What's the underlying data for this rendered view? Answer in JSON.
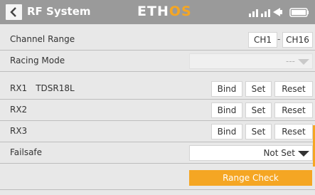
{
  "header": {
    "title": "RF System",
    "logo_prefix": "ETH",
    "logo_suffix": "OS"
  },
  "rows": {
    "channel_range": {
      "label": "Channel Range",
      "from": "CH1",
      "separator": "-",
      "to": "CH16"
    },
    "racing_mode": {
      "label": "Racing Mode",
      "value": "---"
    },
    "rx1": {
      "label": "RX1",
      "model": "TDSR18L",
      "bind": "Bind",
      "set": "Set",
      "reset": "Reset"
    },
    "rx2": {
      "label": "RX2",
      "bind": "Bind",
      "set": "Set",
      "reset": "Reset"
    },
    "rx3": {
      "label": "RX3",
      "bind": "Bind",
      "set": "Set",
      "reset": "Reset"
    },
    "failsafe": {
      "label": "Failsafe",
      "value": "Not Set"
    }
  },
  "range_check": {
    "label": "Range Check"
  },
  "colors": {
    "header_bg": "#9a9a9a",
    "accent": "#f5a623",
    "row_bg": "#e8e8e8",
    "button_bg": "#ffffff"
  },
  "icons": [
    "chevron-left-icon",
    "signal-icon",
    "battery-icon",
    "chevron-down-icon"
  ]
}
